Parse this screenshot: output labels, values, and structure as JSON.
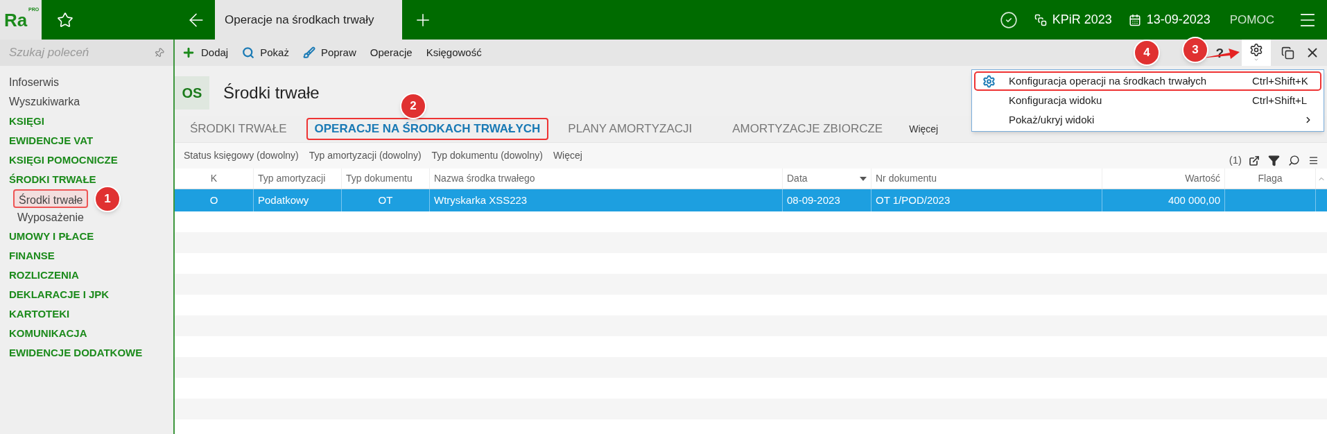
{
  "topbar": {
    "logo": "Ra",
    "logo_badge": "PRO",
    "tab_title": "Operacje na środkach trwały",
    "ledger": "KPiR 2023",
    "date": "13-09-2023",
    "help": "POMOC"
  },
  "sidebar": {
    "search_placeholder": "Szukaj poleceń",
    "items": [
      {
        "label": "Infoserwis",
        "kind": "link"
      },
      {
        "label": "Wyszukiwarka",
        "kind": "link"
      },
      {
        "label": "KSIĘGI",
        "kind": "section"
      },
      {
        "label": "EWIDENCJE VAT",
        "kind": "section"
      },
      {
        "label": "KSIĘGI POMOCNICZE",
        "kind": "section"
      },
      {
        "label": "ŚRODKI TRWAŁE",
        "kind": "section",
        "children": [
          {
            "label": "Środki trwałe",
            "outlined": true
          },
          {
            "label": "Wyposażenie",
            "outlined": false
          }
        ]
      },
      {
        "label": "UMOWY I PŁACE",
        "kind": "section"
      },
      {
        "label": "FINANSE",
        "kind": "section"
      },
      {
        "label": "ROZLICZENIA",
        "kind": "section"
      },
      {
        "label": "DEKLARACJE I JPK",
        "kind": "section"
      },
      {
        "label": "KARTOTEKI",
        "kind": "section"
      },
      {
        "label": "KOMUNIKACJA",
        "kind": "section"
      },
      {
        "label": "EWIDENCJE DODATKOWE",
        "kind": "section"
      }
    ]
  },
  "toolbar": {
    "actions": [
      {
        "label": "Dodaj",
        "kind": "add"
      },
      {
        "label": "Pokaż",
        "kind": "search"
      },
      {
        "label": "Popraw",
        "kind": "edit"
      },
      {
        "label": "Operacje",
        "kind": "plain"
      },
      {
        "label": "Księgowość",
        "kind": "plain"
      }
    ],
    "help": "?"
  },
  "header": {
    "badge": "OS",
    "title": "Środki trwałe"
  },
  "tabs": [
    {
      "label": "ŚRODKI TRWAŁE",
      "kind": "tab",
      "selected": false,
      "outlined": false
    },
    {
      "label": "OPERACJE NA ŚRODKACH TRWAŁYCH",
      "kind": "tab",
      "selected": true,
      "outlined": true
    },
    {
      "label": "PLANY AMORTYZACJI",
      "kind": "tab",
      "selected": false,
      "outlined": false
    },
    {
      "label": "AMORTYZACJE ZBIORCZE",
      "kind": "tab",
      "selected": false,
      "outlined": false
    },
    {
      "label": "Więcej",
      "kind": "more",
      "selected": false,
      "outlined": false
    }
  ],
  "filters": [
    "Status księgowy (dowolny)",
    "Typ amortyzacji (dowolny)",
    "Typ dokumentu (dowolny)",
    "Więcej"
  ],
  "filter_count": "(1)",
  "table": {
    "columns": [
      {
        "label": "K",
        "sorted": false
      },
      {
        "label": "Typ amortyzacji",
        "sorted": false
      },
      {
        "label": "Typ dokumentu",
        "sorted": false
      },
      {
        "label": "Nazwa środka trwałego",
        "sorted": false
      },
      {
        "label": "Data",
        "sorted": true
      },
      {
        "label": "Nr dokumentu",
        "sorted": false
      },
      {
        "label": "Wartość",
        "sorted": false
      },
      {
        "label": "Flaga",
        "sorted": false
      }
    ],
    "rows": [
      {
        "cells": [
          "O",
          "Podatkowy",
          "OT",
          "Wtryskarka XSS223",
          "08-09-2023",
          "OT 1/POD/2023",
          "400 000,00",
          ""
        ],
        "selected": true
      }
    ]
  },
  "menu": {
    "items": [
      {
        "label": "Konfiguracja operacji na środkach trwałych",
        "shortcut": "Ctrl+Shift+K",
        "kind": "gear",
        "outlined": true
      },
      {
        "label": "Konfiguracja widoku",
        "shortcut": "Ctrl+Shift+L",
        "kind": "plain",
        "outlined": false
      },
      {
        "label": "Pokaż/ukryj widoki",
        "kind": "submenu",
        "outlined": false
      }
    ]
  },
  "annotations": [
    "1",
    "2",
    "3",
    "4"
  ]
}
